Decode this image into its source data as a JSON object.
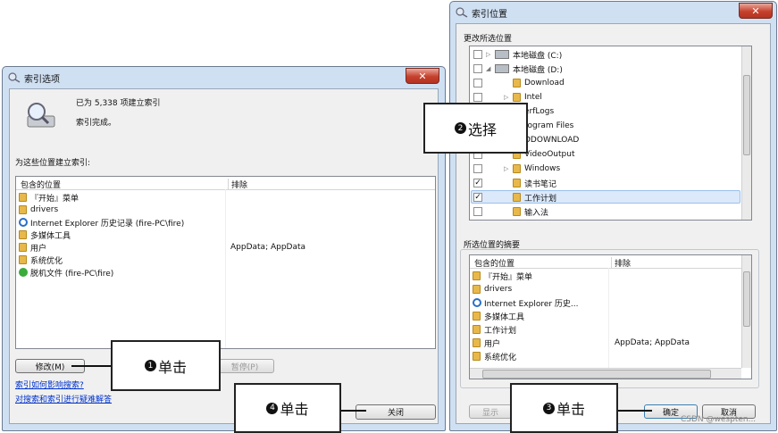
{
  "window1": {
    "title": "索引选项",
    "close": "✕",
    "status_count": "已为 5,338 项建立索引",
    "status_state": "索引完成。",
    "locations_label": "为这些位置建立索引:",
    "col_included": "包含的位置",
    "col_excluded": "排除",
    "items": [
      {
        "icon": "folder-icon",
        "label": "『开始』菜单",
        "excluded": ""
      },
      {
        "icon": "folder-icon",
        "label": "drivers",
        "excluded": ""
      },
      {
        "icon": "ie-icon",
        "label": "Internet Explorer 历史记录 (fire-PC\\fire)",
        "excluded": ""
      },
      {
        "icon": "folder-icon",
        "label": "多媒体工具",
        "excluded": ""
      },
      {
        "icon": "folder-icon",
        "label": "用户",
        "excluded": "AppData; AppData"
      },
      {
        "icon": "folder-icon",
        "label": "系统优化",
        "excluded": ""
      },
      {
        "icon": "offline-icon",
        "label": "脱机文件 (fire-PC\\fire)",
        "excluded": ""
      }
    ],
    "modify_button": "修改(M)",
    "pause_button": "暂停(P)",
    "link1": "索引如何影响搜索?",
    "link2": "对搜索和索引进行疑难解答",
    "close_button": "关闭"
  },
  "window2": {
    "title": "索引位置",
    "close": "✕",
    "change_label": "更改所选位置",
    "tree": [
      {
        "label": "本地磁盘 (C:)",
        "checked": false,
        "level": 0,
        "icon": "drive-icon",
        "arrow": "▷"
      },
      {
        "label": "本地磁盘 (D:)",
        "checked": false,
        "level": 0,
        "icon": "drive-icon",
        "arrow": "◢"
      },
      {
        "label": "Download",
        "checked": false,
        "level": 1,
        "icon": "folder-icon",
        "arrow": ""
      },
      {
        "label": "Intel",
        "checked": false,
        "level": 1,
        "icon": "folder-icon",
        "arrow": "▷"
      },
      {
        "label": "erfLogs",
        "checked": false,
        "level": 1,
        "icon": "folder-icon",
        "arrow": ""
      },
      {
        "label": "rogram Files",
        "checked": false,
        "level": 1,
        "icon": "folder-icon",
        "arrow": ""
      },
      {
        "label": "DDOWNLOAD",
        "checked": false,
        "level": 1,
        "icon": "folder-icon",
        "arrow": ""
      },
      {
        "label": "VideoOutput",
        "checked": false,
        "level": 1,
        "icon": "folder-icon",
        "arrow": ""
      },
      {
        "label": "Windows",
        "checked": false,
        "level": 1,
        "icon": "folder-icon",
        "arrow": "▷"
      },
      {
        "label": "读书笔记",
        "checked": true,
        "level": 1,
        "icon": "folder-icon",
        "arrow": ""
      },
      {
        "label": "工作计划",
        "checked": true,
        "level": 1,
        "icon": "folder-icon",
        "arrow": "",
        "selected": true
      },
      {
        "label": "输入法",
        "checked": false,
        "level": 1,
        "icon": "folder-icon",
        "arrow": ""
      }
    ],
    "summary_label": "所选位置的摘要",
    "col_included": "包含的位置",
    "col_excluded": "排除",
    "summary_items": [
      {
        "icon": "folder-icon",
        "label": "『开始』菜单",
        "excluded": ""
      },
      {
        "icon": "folder-icon",
        "label": "drivers",
        "excluded": ""
      },
      {
        "icon": "ie-icon",
        "label": "Internet Explorer 历史...",
        "excluded": ""
      },
      {
        "icon": "folder-icon",
        "label": "多媒体工具",
        "excluded": ""
      },
      {
        "icon": "folder-icon",
        "label": "工作计划",
        "excluded": ""
      },
      {
        "icon": "folder-icon",
        "label": "用户",
        "excluded": "AppData; AppData"
      },
      {
        "icon": "folder-icon",
        "label": "系统优化",
        "excluded": ""
      }
    ],
    "show_all_button": "显示",
    "ok_button": "确定",
    "cancel_button": "取消"
  },
  "callouts": {
    "c1_num": "1",
    "c1_text": "单击",
    "c2_num": "2",
    "c2_text": "选择",
    "c3_num": "3",
    "c3_text": "单击",
    "c4_num": "4",
    "c4_text": "单击"
  },
  "watermark": "CSDN @wespten..."
}
